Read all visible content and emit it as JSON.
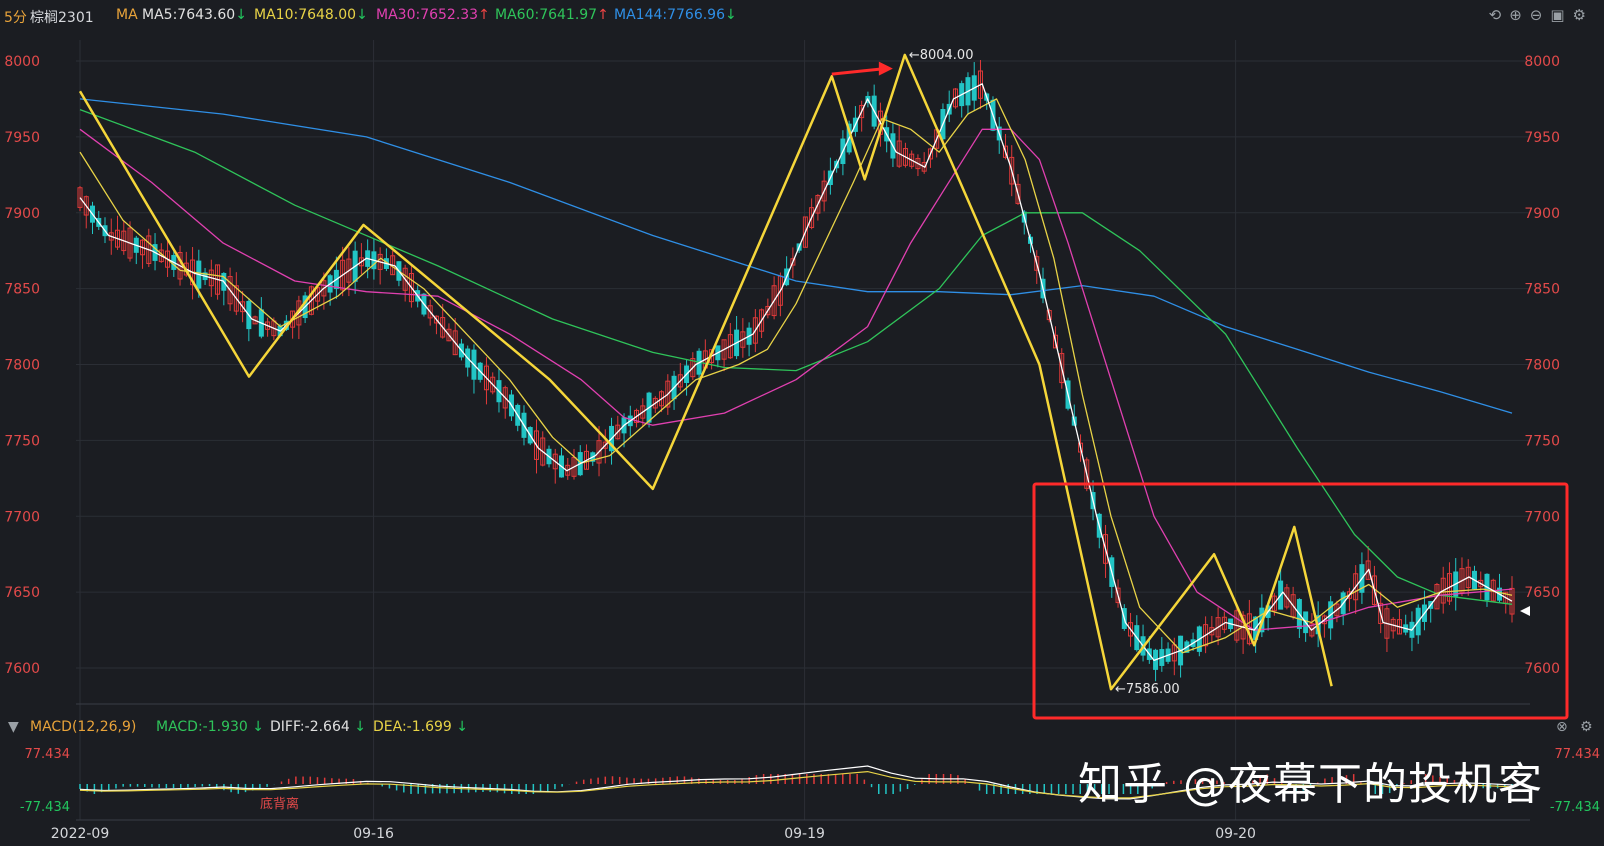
{
  "header": {
    "period": "5分",
    "symbol": "棕榈2301",
    "ma_label": "MA",
    "ma5": "MA5:7643.60",
    "ma10": "MA10:7648.00",
    "ma30": "MA30:7652.33",
    "ma60": "MA60:7641.97",
    "ma144": "MA144:7766.96",
    "ma5_dir": "↓",
    "ma10_dir": "↓",
    "ma30_dir": "↑",
    "ma60_dir": "↑",
    "ma144_dir": "↓"
  },
  "macd_header": {
    "name": "MACD(12,26,9)",
    "macd": "MACD:-1.930",
    "diff": "DIFF:-2.664",
    "dea": "DEA:-1.699",
    "macd_dir": "↓",
    "diff_dir": "↓",
    "dea_dir": "↓"
  },
  "annotations": {
    "high_label": "8004.00",
    "low_label": "7586.00",
    "divergence": "底背离",
    "watermark": "知乎 @夜幕下的投机客"
  },
  "colors": {
    "up": "#e03a3a",
    "down": "#22c5c5",
    "ma5": "#ffffff",
    "ma10": "#e8d347",
    "ma30": "#e040b0",
    "ma60": "#2fc45a",
    "ma144": "#2f8fe6",
    "zigzag": "#f5d63a",
    "box": "#ff2a2a"
  },
  "chart_data": {
    "type": "line",
    "title": "棕榈2301 5分",
    "y_ticks": [
      8000,
      7950,
      7900,
      7850,
      7800,
      7750,
      7700,
      7650,
      7600
    ],
    "ylim": [
      7578,
      8015
    ],
    "macd_ticks": [
      "77.434",
      "-77.434"
    ],
    "x_labels": [
      {
        "label": "2022-09",
        "t": 0
      },
      {
        "label": "09-16",
        "t": 0.205
      },
      {
        "label": "09-19",
        "t": 0.506
      },
      {
        "label": "09-20",
        "t": 0.807
      }
    ],
    "series": [
      {
        "name": "MA144",
        "key": "ma144",
        "points": [
          [
            0,
            7975
          ],
          [
            0.1,
            7965
          ],
          [
            0.2,
            7950
          ],
          [
            0.3,
            7920
          ],
          [
            0.4,
            7885
          ],
          [
            0.5,
            7855
          ],
          [
            0.55,
            7848
          ],
          [
            0.6,
            7848
          ],
          [
            0.65,
            7846
          ],
          [
            0.7,
            7852
          ],
          [
            0.75,
            7845
          ],
          [
            0.8,
            7825
          ],
          [
            0.85,
            7810
          ],
          [
            0.9,
            7795
          ],
          [
            0.95,
            7782
          ],
          [
            1,
            7768
          ]
        ]
      },
      {
        "name": "MA60",
        "key": "ma60",
        "points": [
          [
            0,
            7968
          ],
          [
            0.08,
            7940
          ],
          [
            0.15,
            7905
          ],
          [
            0.25,
            7865
          ],
          [
            0.33,
            7830
          ],
          [
            0.4,
            7808
          ],
          [
            0.45,
            7798
          ],
          [
            0.5,
            7796
          ],
          [
            0.55,
            7815
          ],
          [
            0.6,
            7850
          ],
          [
            0.63,
            7885
          ],
          [
            0.66,
            7900
          ],
          [
            0.7,
            7900
          ],
          [
            0.74,
            7875
          ],
          [
            0.8,
            7820
          ],
          [
            0.85,
            7745
          ],
          [
            0.89,
            7688
          ],
          [
            0.92,
            7660
          ],
          [
            0.95,
            7648
          ],
          [
            1,
            7642
          ]
        ]
      },
      {
        "name": "MA30",
        "key": "ma30",
        "points": [
          [
            0,
            7955
          ],
          [
            0.05,
            7920
          ],
          [
            0.1,
            7880
          ],
          [
            0.15,
            7855
          ],
          [
            0.2,
            7848
          ],
          [
            0.25,
            7845
          ],
          [
            0.3,
            7820
          ],
          [
            0.35,
            7790
          ],
          [
            0.38,
            7765
          ],
          [
            0.4,
            7760
          ],
          [
            0.45,
            7768
          ],
          [
            0.5,
            7790
          ],
          [
            0.55,
            7825
          ],
          [
            0.58,
            7880
          ],
          [
            0.61,
            7925
          ],
          [
            0.63,
            7955
          ],
          [
            0.65,
            7955
          ],
          [
            0.67,
            7935
          ],
          [
            0.69,
            7880
          ],
          [
            0.72,
            7790
          ],
          [
            0.75,
            7700
          ],
          [
            0.78,
            7650
          ],
          [
            0.82,
            7625
          ],
          [
            0.86,
            7628
          ],
          [
            0.9,
            7640
          ],
          [
            0.95,
            7648
          ],
          [
            1,
            7652
          ]
        ]
      },
      {
        "name": "MA10",
        "key": "ma10",
        "points": [
          [
            0,
            7940
          ],
          [
            0.03,
            7895
          ],
          [
            0.07,
            7862
          ],
          [
            0.1,
            7858
          ],
          [
            0.14,
            7825
          ],
          [
            0.18,
            7845
          ],
          [
            0.21,
            7870
          ],
          [
            0.24,
            7850
          ],
          [
            0.27,
            7820
          ],
          [
            0.3,
            7790
          ],
          [
            0.33,
            7752
          ],
          [
            0.35,
            7735
          ],
          [
            0.37,
            7740
          ],
          [
            0.4,
            7765
          ],
          [
            0.43,
            7790
          ],
          [
            0.46,
            7800
          ],
          [
            0.48,
            7810
          ],
          [
            0.5,
            7840
          ],
          [
            0.52,
            7880
          ],
          [
            0.54,
            7920
          ],
          [
            0.56,
            7962
          ],
          [
            0.58,
            7955
          ],
          [
            0.6,
            7940
          ],
          [
            0.62,
            7965
          ],
          [
            0.64,
            7975
          ],
          [
            0.66,
            7935
          ],
          [
            0.68,
            7870
          ],
          [
            0.7,
            7780
          ],
          [
            0.72,
            7700
          ],
          [
            0.74,
            7640
          ],
          [
            0.77,
            7610
          ],
          [
            0.8,
            7620
          ],
          [
            0.83,
            7638
          ],
          [
            0.86,
            7630
          ],
          [
            0.88,
            7645
          ],
          [
            0.9,
            7655
          ],
          [
            0.92,
            7640
          ],
          [
            0.95,
            7650
          ],
          [
            0.98,
            7652
          ],
          [
            1,
            7648
          ]
        ]
      },
      {
        "name": "MA5",
        "key": "ma5",
        "points": [
          [
            0,
            7910
          ],
          [
            0.02,
            7885
          ],
          [
            0.05,
            7875
          ],
          [
            0.08,
            7860
          ],
          [
            0.1,
            7855
          ],
          [
            0.12,
            7830
          ],
          [
            0.14,
            7822
          ],
          [
            0.17,
            7850
          ],
          [
            0.2,
            7870
          ],
          [
            0.22,
            7865
          ],
          [
            0.24,
            7840
          ],
          [
            0.27,
            7805
          ],
          [
            0.3,
            7775
          ],
          [
            0.32,
            7745
          ],
          [
            0.34,
            7730
          ],
          [
            0.36,
            7740
          ],
          [
            0.38,
            7760
          ],
          [
            0.41,
            7780
          ],
          [
            0.43,
            7800
          ],
          [
            0.45,
            7810
          ],
          [
            0.47,
            7820
          ],
          [
            0.49,
            7850
          ],
          [
            0.51,
            7895
          ],
          [
            0.53,
            7935
          ],
          [
            0.55,
            7975
          ],
          [
            0.57,
            7940
          ],
          [
            0.59,
            7930
          ],
          [
            0.61,
            7975
          ],
          [
            0.63,
            7985
          ],
          [
            0.65,
            7930
          ],
          [
            0.67,
            7860
          ],
          [
            0.69,
            7780
          ],
          [
            0.71,
            7700
          ],
          [
            0.73,
            7630
          ],
          [
            0.75,
            7605
          ],
          [
            0.77,
            7612
          ],
          [
            0.8,
            7630
          ],
          [
            0.82,
            7625
          ],
          [
            0.84,
            7650
          ],
          [
            0.86,
            7625
          ],
          [
            0.88,
            7640
          ],
          [
            0.9,
            7665
          ],
          [
            0.91,
            7630
          ],
          [
            0.93,
            7625
          ],
          [
            0.95,
            7650
          ],
          [
            0.97,
            7660
          ],
          [
            1,
            7644
          ]
        ]
      },
      {
        "name": "ZigZag",
        "key": "zigzag",
        "points": [
          [
            0,
            7980
          ],
          [
            0.118,
            7792
          ],
          [
            0.198,
            7892
          ],
          [
            0.328,
            7790
          ],
          [
            0.4,
            7718
          ],
          [
            0.525,
            7990
          ],
          [
            0.548,
            7922
          ],
          [
            0.576,
            8004
          ],
          [
            0.67,
            7800
          ],
          [
            0.72,
            7586
          ],
          [
            0.792,
            7675
          ],
          [
            0.82,
            7615
          ],
          [
            0.848,
            7693
          ],
          [
            0.874,
            7588
          ]
        ]
      }
    ]
  }
}
